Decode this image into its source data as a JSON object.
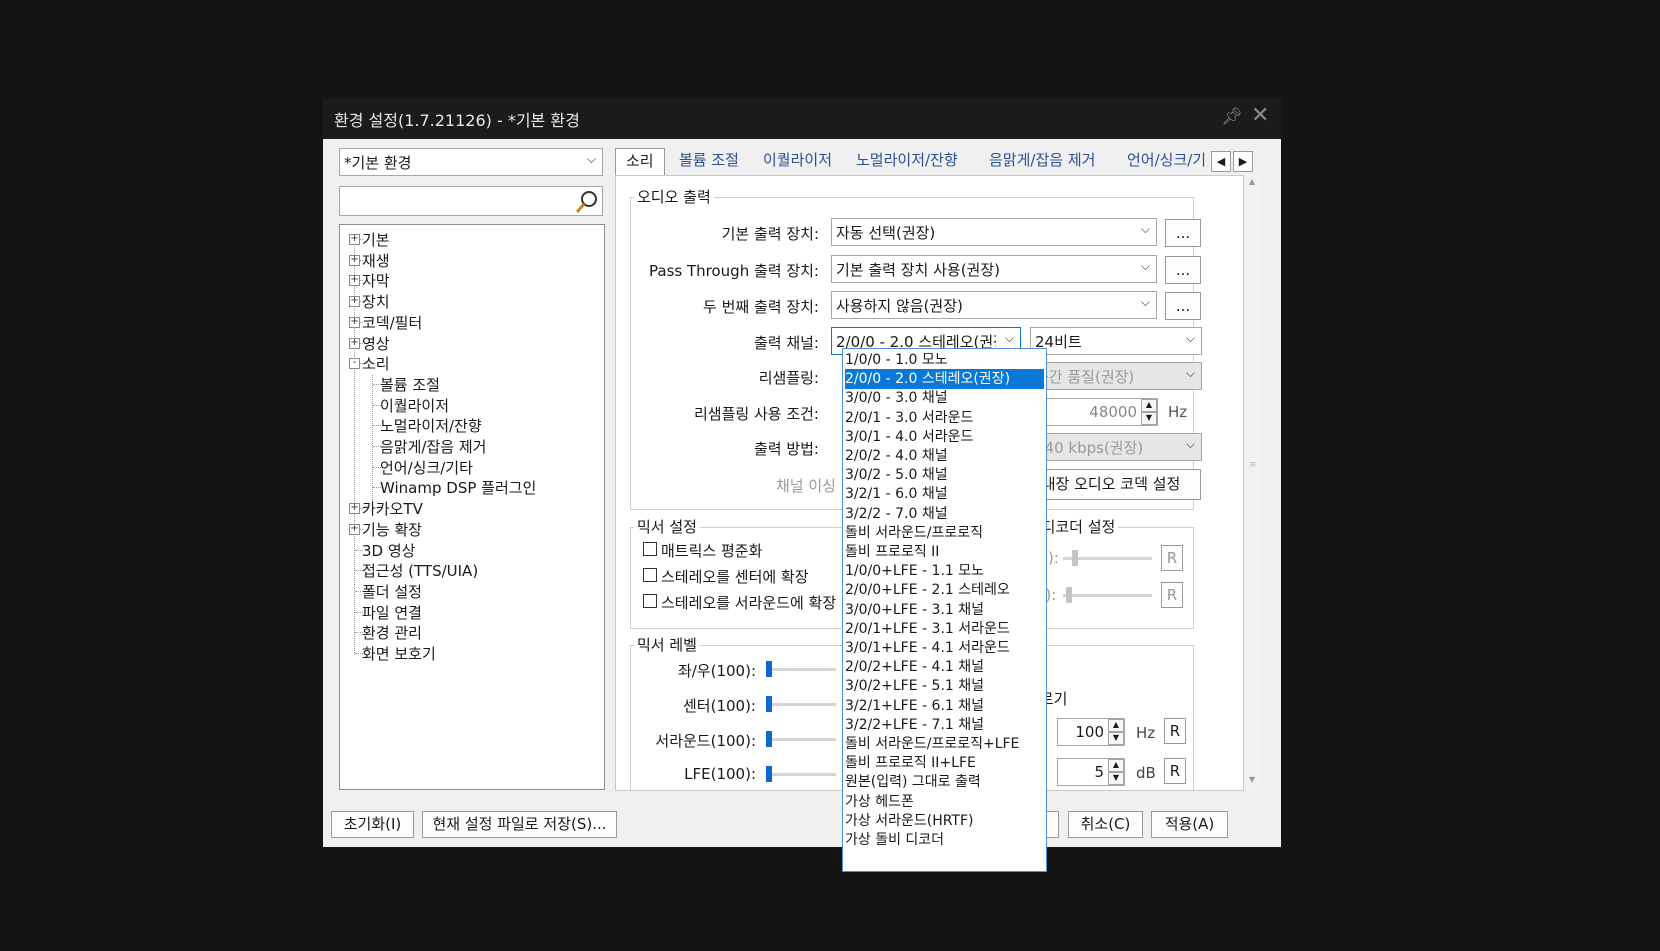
{
  "window": {
    "title": "환경 설정(1.7.21126) - *기본 환경",
    "pin_icon": "pin-icon",
    "close_icon": "close-icon"
  },
  "preset": {
    "value": "*기본 환경"
  },
  "search": {
    "value": "",
    "icon": "search-icon"
  },
  "tree": {
    "items": [
      {
        "label": "기본",
        "expander": "+"
      },
      {
        "label": "재생",
        "expander": "+"
      },
      {
        "label": "자막",
        "expander": "+"
      },
      {
        "label": "장치",
        "expander": "+"
      },
      {
        "label": "코덱/필터",
        "expander": "+"
      },
      {
        "label": "영상",
        "expander": "+"
      },
      {
        "label": "소리",
        "expander": "-"
      },
      {
        "label": "볼륨 조절"
      },
      {
        "label": "이퀄라이저"
      },
      {
        "label": "노멀라이저/잔향"
      },
      {
        "label": "음맑게/잡음 제거"
      },
      {
        "label": "언어/싱크/기타"
      },
      {
        "label": "Winamp DSP 플러그인"
      },
      {
        "label": "카카오TV",
        "expander": "+"
      },
      {
        "label": "기능 확장",
        "expander": "+"
      },
      {
        "label": "3D 영상"
      },
      {
        "label": "접근성 (TTS/UIA)"
      },
      {
        "label": "폴더 설정"
      },
      {
        "label": "파일 연결"
      },
      {
        "label": "환경 관리"
      },
      {
        "label": "화면 보호기"
      }
    ]
  },
  "tabs": [
    "소리",
    "볼륨 조절",
    "이퀄라이저",
    "노멀라이저/잔향",
    "음맑게/잡음 제거",
    "언어/싱크/기"
  ],
  "audio_output": {
    "group_label": "오디오 출력",
    "default_device_label": "기본 출력 장치:",
    "default_device_value": "자동 선택(권장)",
    "passthrough_label": "Pass Through 출력 장치:",
    "passthrough_value": "기본 출력 장치 사용(권장)",
    "second_device_label": "두 번째 출력 장치:",
    "second_device_value": "사용하지 않음(권장)",
    "more_button": "...",
    "channel_label": "출력 채널:",
    "channel_value": "2/0/0 - 2.0 스테레오(권장)",
    "bits_value": "24비트",
    "resample_label": "리샘플링:",
    "resample_value": "중간 품질(권장)",
    "resample_cond_label": "리샘플링 사용 조건:",
    "resample_hz_value": "48000",
    "hz_unit": "Hz",
    "output_method_label": "출력 방법:",
    "output_method_value": "640 kbps(권장)",
    "channel_note": "채널 이싱",
    "codec_button": "내장 오디오 코덱 설정"
  },
  "mixer": {
    "group_label": "믹서 설정",
    "opt1": "매트릭스 평준화",
    "opt2": "스테레오를 센터에 확장",
    "opt3": "스테레오를 서라운드에 확장",
    "decoder_group_label": "비 디코더 설정",
    "dec_row1_label": "(10):",
    "dec_row2_label": "ms):",
    "reset": "R"
  },
  "mixer_level": {
    "group_label": "믹서 레벨",
    "lr": "좌/우(100):",
    "center": "센터(100):",
    "surround": "서라운드(100):",
    "lfe": "LFE(100):",
    "lr_level": 1.0,
    "center_level": 1.0,
    "surround_level": 1.0,
    "lfe_level": 1.0,
    "trim_label": "자르기",
    "freq_label": "수:",
    "freq_value": "100",
    "freq_unit": "Hz",
    "gain_label": "득:",
    "gain_value": "5",
    "gain_unit": "dB",
    "reset": "R"
  },
  "channel_options": [
    "1/0/0 - 1.0 모노",
    "2/0/0 - 2.0 스테레오(권장)",
    "3/0/0 - 3.0 채널",
    "2/0/1 - 3.0 서라운드",
    "3/0/1 - 4.0 서라운드",
    "2/0/2 - 4.0 채널",
    "3/0/2 - 5.0 채널",
    "3/2/1 - 6.0 채널",
    "3/2/2 - 7.0 채널",
    "돌비 서라운드/프로로직",
    "돌비 프로로직 II",
    "1/0/0+LFE - 1.1 모노",
    "2/0/0+LFE - 2.1 스테레오",
    "3/0/0+LFE - 3.1 채널",
    "2/0/1+LFE - 3.1 서라운드",
    "3/0/1+LFE - 4.1 서라운드",
    "2/0/2+LFE - 4.1 채널",
    "3/0/2+LFE - 5.1 채널",
    "3/2/1+LFE - 6.1 채널",
    "3/2/2+LFE - 7.1 채널",
    "돌비 서라운드/프로로직+LFE",
    "돌비 프로로직 II+LFE",
    "원본(입력) 그대로 출력",
    "가상 헤드폰",
    "가상 서라운드(HRTF)",
    "가상 돌비 디코더"
  ],
  "selected_option_index": 1,
  "footer": {
    "reset": "초기화(I)",
    "save": "현재 설정 파일로 저장(S)...",
    "ok": "인(O)",
    "cancel": "취소(C)",
    "apply": "적용(A)"
  }
}
